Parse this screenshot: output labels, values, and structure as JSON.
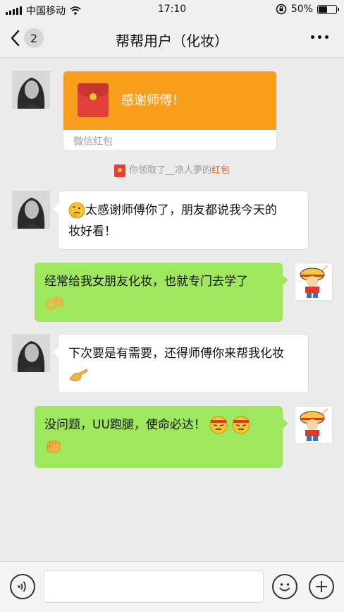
{
  "status_bar": {
    "carrier": "中国移动",
    "time": "17:10",
    "battery_text": "50%",
    "battery_level": 0.5
  },
  "nav": {
    "unread_count": "2",
    "title": "帮帮用户（化妆）"
  },
  "messages": {
    "red_packet": {
      "title": "感谢师傅！",
      "footer": "微信红包"
    },
    "system_note": {
      "prefix": "你领取了__凉人夢的",
      "link": "红包"
    },
    "m1": {
      "line1": "太感谢师傅你了，朋友都说我今天的",
      "line2": "妆好看！"
    },
    "m2": {
      "line1": "经常给我女朋友化妆，也就专门去学了"
    },
    "m3": {
      "line1": "下次要是有需要，还得师傅你来帮我化妆"
    },
    "m4": {
      "line1": "没问题，UU跑腿，使命必达！"
    }
  },
  "input_bar": {
    "value": "",
    "placeholder": ""
  },
  "icons": {
    "voice": "voice-icon",
    "emoji": "emoji-icon",
    "add": "plus-icon"
  },
  "colors": {
    "green_bubble": "#9fe85e",
    "red_packet": "#f99d1c",
    "link": "#e8641b"
  }
}
